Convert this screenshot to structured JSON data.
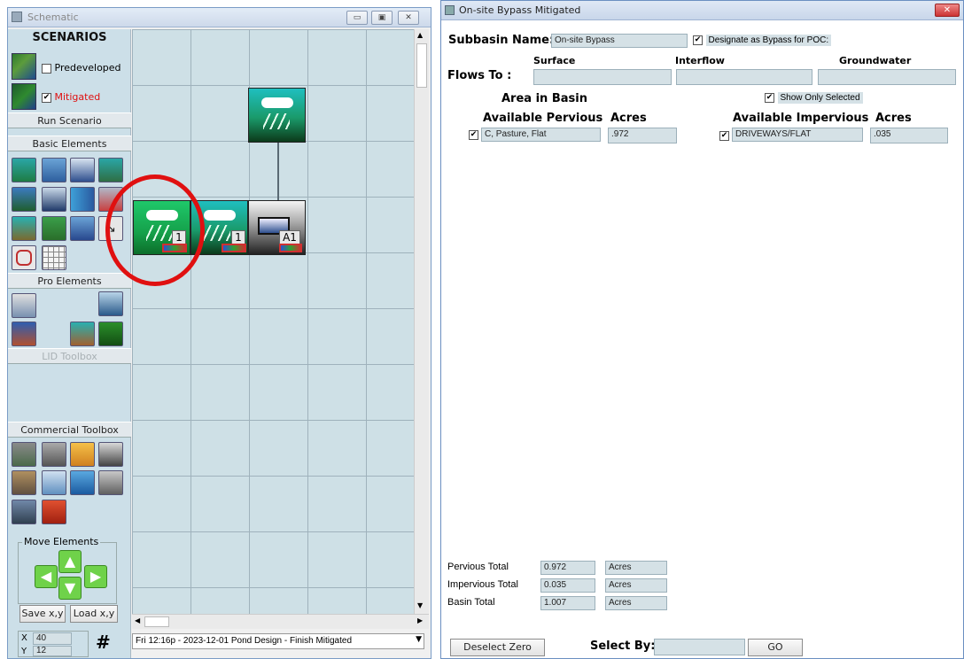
{
  "schematic": {
    "title": "Schematic",
    "scenarios_header": "SCENARIOS",
    "predeveloped_label": "Predeveloped",
    "mitigated_label": "Mitigated",
    "run_scenario": "Run Scenario",
    "basic_elements": "Basic Elements",
    "pro_elements": "Pro Elements",
    "lid_toolbox": "LID Toolbox",
    "commercial_toolbox": "Commercial Toolbox",
    "move_elements": "Move Elements",
    "save_xy": "Save x,y",
    "load_xy": "Load x,y",
    "x_label": "X",
    "x_value": "40",
    "y_label": "Y",
    "y_value": "12",
    "hash": "#",
    "status": "Fri 12:16p - 2023-12-01 Pond Design - Finish Mitigated",
    "tile1_num": "1",
    "tile2_num": "1",
    "tile3_num": "A1"
  },
  "bypass": {
    "title": "On-site Bypass Mitigated",
    "subbasin_label": "Subbasin Name:",
    "subbasin_value": "On-site Bypass",
    "designate_label": "Designate as Bypass for POC:",
    "flows_to": "Flows To :",
    "surface": "Surface",
    "interflow": "Interflow",
    "groundwater": "Groundwater",
    "area_in_basin": "Area in Basin",
    "show_only_selected": "Show Only Selected",
    "available_pervious": "Available Pervious",
    "acres1": "Acres",
    "pervious_item": "C, Pasture, Flat",
    "pervious_value": ".972",
    "available_impervious": "Available Impervious",
    "acres2": "Acres",
    "impervious_item": "DRIVEWAYS/FLAT",
    "impervious_value": ".035",
    "pervious_total_label": "Pervious Total",
    "pervious_total": "0.972",
    "impervious_total_label": "Impervious Total",
    "impervious_total": "0.035",
    "basin_total_label": "Basin Total",
    "basin_total": "1.007",
    "acres_unit": "Acres",
    "deselect_zero": "Deselect Zero",
    "select_by": "Select By:",
    "go": "GO"
  },
  "colors": {
    "highlight_circle": "#e01010",
    "grid": "#cee0e6",
    "panel": "#ccdfe8"
  }
}
